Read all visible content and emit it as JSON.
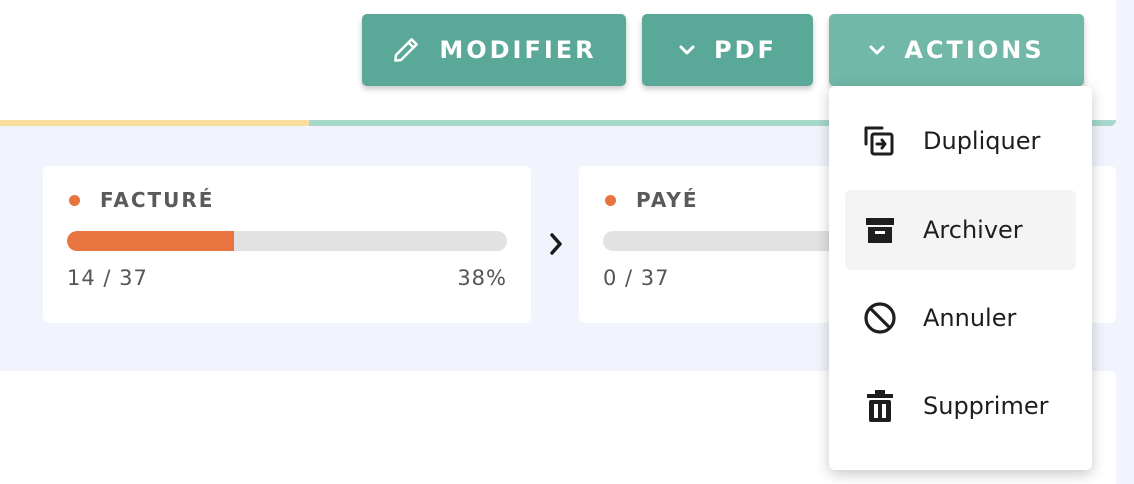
{
  "toolbar": {
    "modifier_label": "MODIFIER",
    "pdf_label": "PDF",
    "actions_label": "ACTIONS",
    "accent_color": "#5aa898"
  },
  "status_cards": [
    {
      "title": "FACTURÉ",
      "count": "14 / 37",
      "percent": "38%",
      "progress": 0.38,
      "dot_color": "#e8743f"
    },
    {
      "title": "PAYÉ",
      "count": "0 / 37",
      "progress": 0.0,
      "dot_color": "#e8743f"
    }
  ],
  "actions_menu": {
    "items": [
      {
        "label": "Dupliquer",
        "icon": "duplicate-icon"
      },
      {
        "label": "Archiver",
        "icon": "archive-icon",
        "hovered": true
      },
      {
        "label": "Annuler",
        "icon": "cancel-icon"
      },
      {
        "label": "Supprimer",
        "icon": "trash-icon"
      }
    ]
  }
}
